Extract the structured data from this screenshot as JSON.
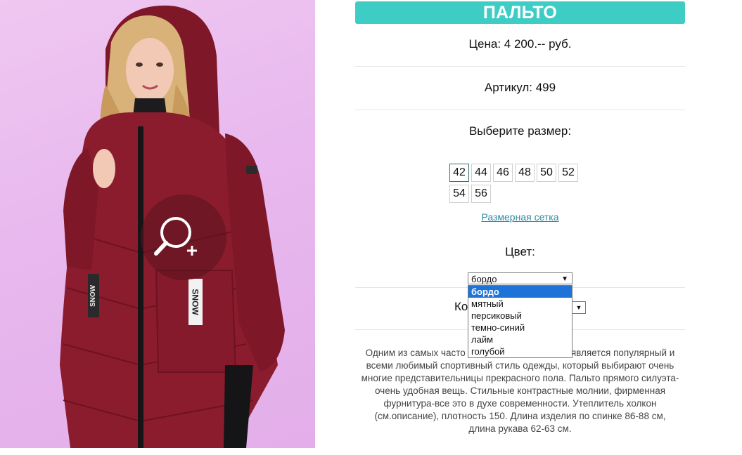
{
  "product": {
    "title": "ПАЛЬТО",
    "price": "Цена: 4 200.-- руб.",
    "article": "Артикул: 499",
    "choose_size": "Выберите размер:",
    "sizes": [
      "42",
      "44",
      "46",
      "48",
      "50",
      "52",
      "54",
      "56"
    ],
    "selected_size": "42",
    "size_chart_link": "Размерная сетка",
    "color_label": "Цвет:",
    "color_select_value": "бордо",
    "color_options": [
      "бордо",
      "мятный",
      "персиковый",
      "темно-синий",
      "лайм",
      "голубой"
    ],
    "qty_label_partial": "Ко",
    "description": "Одним из самых часто ... является популярный и всеми любимый спортивный стиль одежды, который выбирают очень многие представительницы прекрасного пола. Пальто прямого силуэта-очень удобная вещь. Стильные контрастные молнии, фирменная фурнитура-все это в духе современности. Утеплитель холкон (см.описание), плотность 150. Длина изделия по спинке 86-88 см, длина рукава 62-63 см.",
    "desc_lines": [
      "Одним из самых часто",
      "является популярный и",
      "всеми любимый спортивный стиль одежды, который выбирают очень",
      "многие представительницы прекрасного пола. Пальто прямого силуэта-",
      "очень удобная вещь. Стильные контрастные молнии, фирменная",
      "фурнитура-все это в духе современности. Утеплитель холкон",
      "(см.описание), плотность 150. Длина изделия по спинке 86-88 см,",
      "длина рукава 62-63 см."
    ]
  },
  "photo": {
    "sleeve_brand_text": "SNOW",
    "icons": [
      "zoom-in-icon"
    ]
  },
  "colors": {
    "accent": "#3ecdc4",
    "link": "#2e8aa3",
    "coat": "#8a1c2e",
    "highlight": "#1e73d8"
  }
}
